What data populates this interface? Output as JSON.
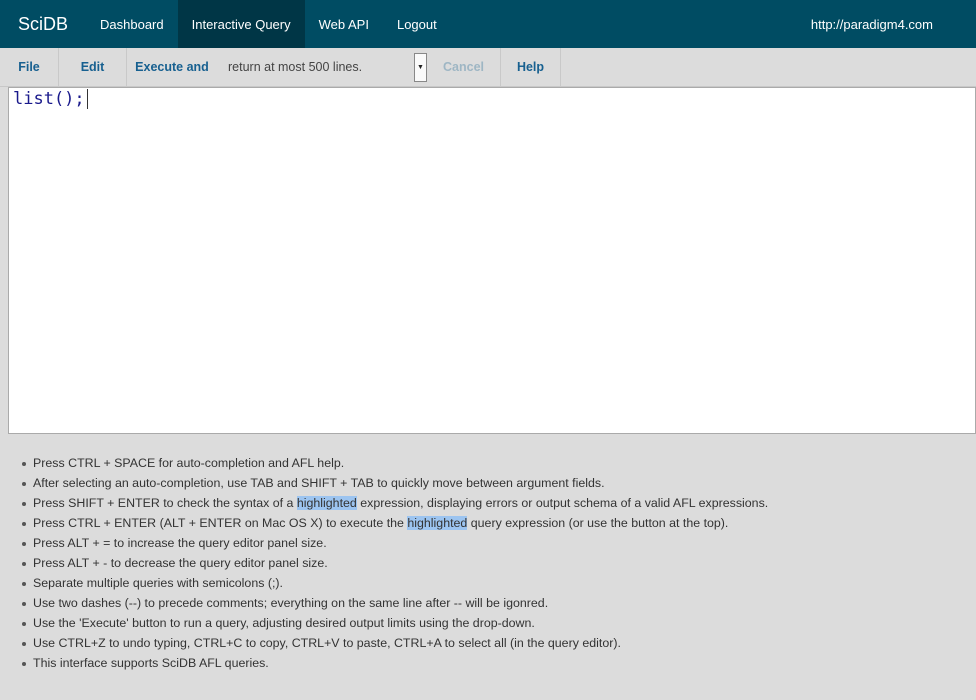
{
  "nav": {
    "brand": "SciDB",
    "items": [
      {
        "label": "Dashboard"
      },
      {
        "label": "Interactive Query",
        "active": true
      },
      {
        "label": "Web API"
      },
      {
        "label": "Logout"
      }
    ],
    "right": "http://paradigm4.com"
  },
  "toolbar": {
    "file": "File",
    "edit": "Edit",
    "execute": "Execute and",
    "limit": "return at most 500 lines.",
    "cancel": "Cancel",
    "help": "Help"
  },
  "editor": {
    "value": "list();"
  },
  "help": [
    {
      "a": "Press CTRL + SPACE for auto-completion and AFL help."
    },
    {
      "a": "After selecting an auto-completion, use TAB and SHIFT + TAB to quickly move between argument fields."
    },
    {
      "a": "Press SHIFT + ENTER to check the syntax of a ",
      "h": "highlighted",
      "b": " expression, displaying errors or output schema of a valid AFL expressions."
    },
    {
      "a": "Press CTRL + ENTER (ALT + ENTER on Mac OS X) to execute the ",
      "h": "highlighted",
      "b": " query expression (or use the button at the top)."
    },
    {
      "a": "Press ALT + = to increase the query editor panel size."
    },
    {
      "a": "Press ALT + - to decrease the query editor panel size."
    },
    {
      "a": "Separate multiple queries with semicolons (;)."
    },
    {
      "a": "Use two dashes (--) to precede comments; everything on the same line after -- will be igonred."
    },
    {
      "a": "Use the 'Execute' button to run a query, adjusting desired output limits using the drop-down."
    },
    {
      "a": "Use CTRL+Z to undo typing, CTRL+C to copy, CTRL+V to paste, CTRL+A to select all (in the query editor)."
    },
    {
      "a": "This interface supports SciDB AFL queries."
    }
  ]
}
